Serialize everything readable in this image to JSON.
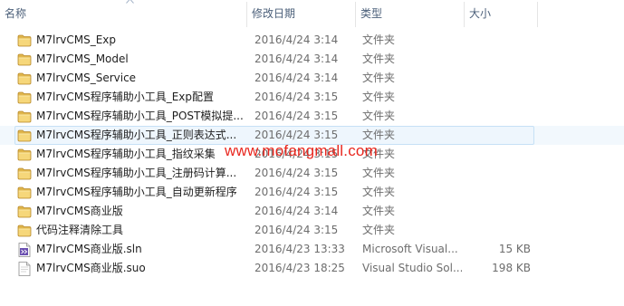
{
  "columns": {
    "name": "名称",
    "date": "修改日期",
    "type": "类型",
    "size": "大小"
  },
  "colors": {
    "header_text": "#4c607a",
    "hover_fill": "#eef6fd",
    "hover_border": "#c6e1f6",
    "watermark": "#e8261e"
  },
  "files": [
    {
      "icon": "folder-icon",
      "name": "M7lrvCMS_Exp",
      "date": "2016/4/24 3:14",
      "type": "文件夹",
      "size": ""
    },
    {
      "icon": "folder-icon",
      "name": "M7lrvCMS_Model",
      "date": "2016/4/24 3:14",
      "type": "文件夹",
      "size": ""
    },
    {
      "icon": "folder-icon",
      "name": "M7lrvCMS_Service",
      "date": "2016/4/24 3:14",
      "type": "文件夹",
      "size": ""
    },
    {
      "icon": "folder-icon",
      "name": "M7lrvCMS程序辅助小工具_Exp配置",
      "date": "2016/4/24 3:15",
      "type": "文件夹",
      "size": ""
    },
    {
      "icon": "folder-icon",
      "name": "M7lrvCMS程序辅助小工具_POST模拟提...",
      "date": "2016/4/24 3:15",
      "type": "文件夹",
      "size": ""
    },
    {
      "icon": "folder-icon",
      "name": "M7lrvCMS程序辅助小工具_正则表达式...",
      "date": "2016/4/24 3:15",
      "type": "文件夹",
      "size": "",
      "hover": true
    },
    {
      "icon": "folder-icon",
      "name": "M7lrvCMS程序辅助小工具_指纹采集",
      "date": "2016/4/24 3:15",
      "type": "文件夹",
      "size": ""
    },
    {
      "icon": "folder-icon",
      "name": "M7lrvCMS程序辅助小工具_注册码计算...",
      "date": "2016/4/24 3:15",
      "type": "文件夹",
      "size": ""
    },
    {
      "icon": "folder-icon",
      "name": "M7lrvCMS程序辅助小工具_自动更新程序",
      "date": "2016/4/24 3:15",
      "type": "文件夹",
      "size": ""
    },
    {
      "icon": "folder-icon",
      "name": "M7lrvCMS商业版",
      "date": "2016/4/24 3:14",
      "type": "文件夹",
      "size": ""
    },
    {
      "icon": "folder-icon",
      "name": "代码注释清除工具",
      "date": "2016/4/24 3:15",
      "type": "文件夹",
      "size": ""
    },
    {
      "icon": "sln-file-icon",
      "name": "M7lrvCMS商业版.sln",
      "date": "2016/4/23 13:33",
      "type": "Microsoft Visual...",
      "size": "15 KB"
    },
    {
      "icon": "suo-file-icon",
      "name": "M7lrvCMS商业版.suo",
      "date": "2016/4/23 18:25",
      "type": "Visual Studio Sol...",
      "size": "198 KB"
    }
  ],
  "watermark": "www.mofangmall.com"
}
